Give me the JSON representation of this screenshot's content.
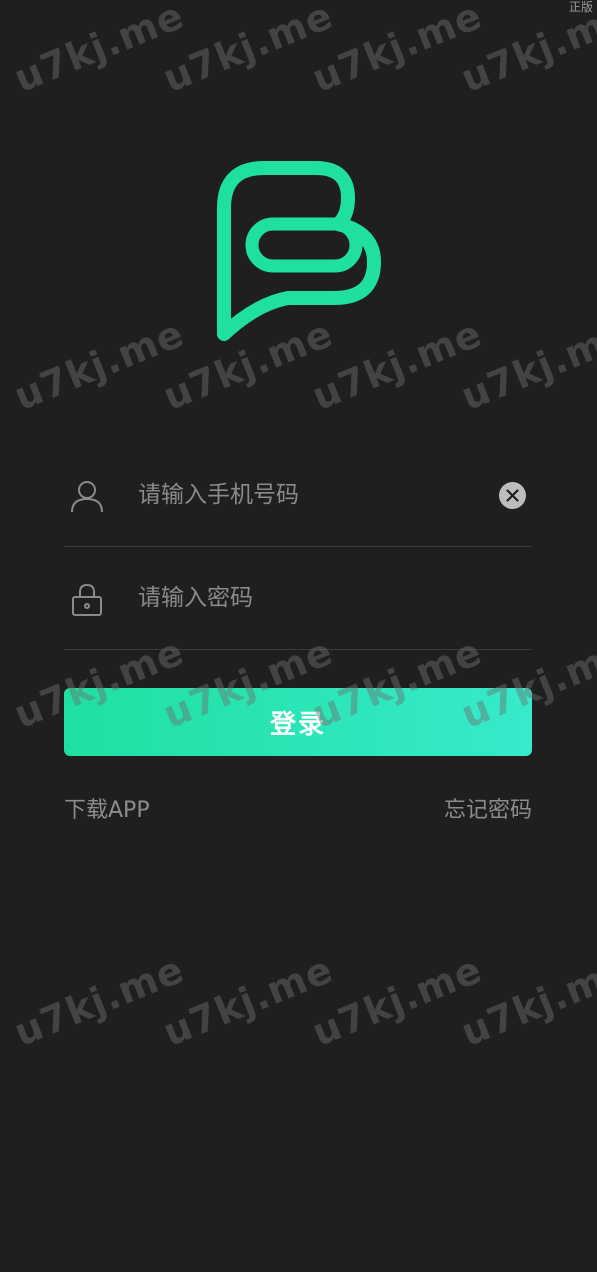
{
  "corner": {
    "label": "正版"
  },
  "watermark": {
    "text": "u7kj.me"
  },
  "login": {
    "phone_placeholder": "请输入手机号码",
    "password_placeholder": "请输入密码",
    "submit_label": "登录"
  },
  "links": {
    "download_app": "下载APP",
    "forgot_password": "忘记密码"
  },
  "colors": {
    "background": "#1f1f1f",
    "accent_start": "#1fe0a1",
    "accent_end": "#37eacb"
  },
  "icons": {
    "logo": "chat-bubble-b-logo",
    "phone_field": "user-icon",
    "password_field": "lock-icon",
    "clear": "clear-icon"
  }
}
